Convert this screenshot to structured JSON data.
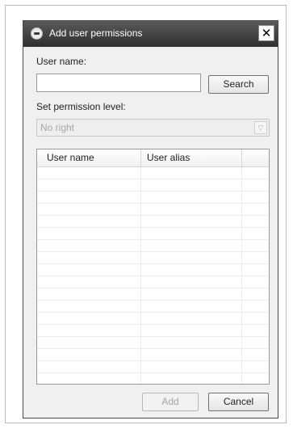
{
  "dialog": {
    "title": "Add user permissions",
    "close_glyph": "✕"
  },
  "form": {
    "user_name_label": "User name:",
    "user_name_value": "",
    "search_button": "Search",
    "permission_label": "Set permission level:",
    "permission_selected": "No right",
    "dropdown_arrow": "▽"
  },
  "table": {
    "columns": [
      "User name",
      "User alias",
      ""
    ],
    "rows": []
  },
  "footer": {
    "add_button": "Add",
    "cancel_button": "Cancel"
  },
  "icons": {
    "title_icon": "app-logo-icon",
    "close_icon": "close-icon",
    "dropdown_icon": "chevron-down-icon"
  }
}
